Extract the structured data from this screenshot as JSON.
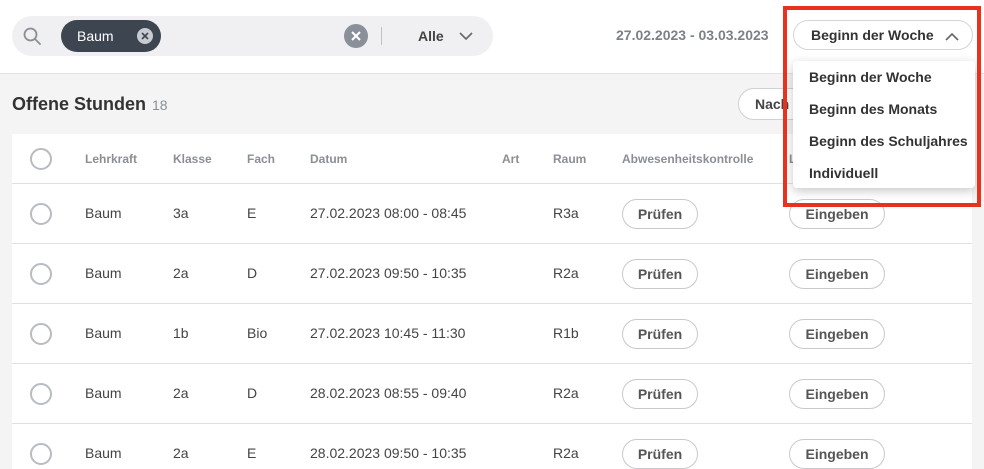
{
  "filter": {
    "chip_label": "Baum",
    "select_label": "Alle"
  },
  "header": {
    "date_range": "27.02.2023 - 03.03.2023",
    "period_selected": "Beginn der Woche"
  },
  "period_menu": {
    "options": [
      "Beginn der Woche",
      "Beginn des Monats",
      "Beginn des Schuljahres",
      "Individuell"
    ]
  },
  "section": {
    "title": "Offene Stunden",
    "count": "18",
    "nach_button": "Nach"
  },
  "table": {
    "columns": [
      "Lehrkraft",
      "Klasse",
      "Fach",
      "Datum",
      "Art",
      "Raum",
      "Abwesenheitskontrolle",
      "L"
    ],
    "action_labels": {
      "check": "Prüfen",
      "enter": "Eingeben"
    },
    "rows": [
      {
        "teacher": "Baum",
        "class": "3a",
        "subject": "E",
        "date": "27.02.2023 08:00 - 08:45",
        "type": "",
        "room": "R3a"
      },
      {
        "teacher": "Baum",
        "class": "2a",
        "subject": "D",
        "date": "27.02.2023 09:50 - 10:35",
        "type": "",
        "room": "R2a"
      },
      {
        "teacher": "Baum",
        "class": "1b",
        "subject": "Bio",
        "date": "27.02.2023 10:45 - 11:30",
        "type": "",
        "room": "R1b"
      },
      {
        "teacher": "Baum",
        "class": "2a",
        "subject": "D",
        "date": "28.02.2023 08:55 - 09:40",
        "type": "",
        "room": "R2a"
      },
      {
        "teacher": "Baum",
        "class": "2a",
        "subject": "E",
        "date": "28.02.2023 09:50 - 10:35",
        "type": "",
        "room": "R2a"
      }
    ]
  },
  "colors": {
    "highlight": "#e8321e",
    "chip_bg": "#3d4650"
  },
  "icons": {
    "search": "search-icon",
    "chip_remove": "close-circle-icon",
    "clear": "clear-icon",
    "select_chevron": "chevron-down-icon",
    "period_chevron": "chevron-up-icon"
  }
}
